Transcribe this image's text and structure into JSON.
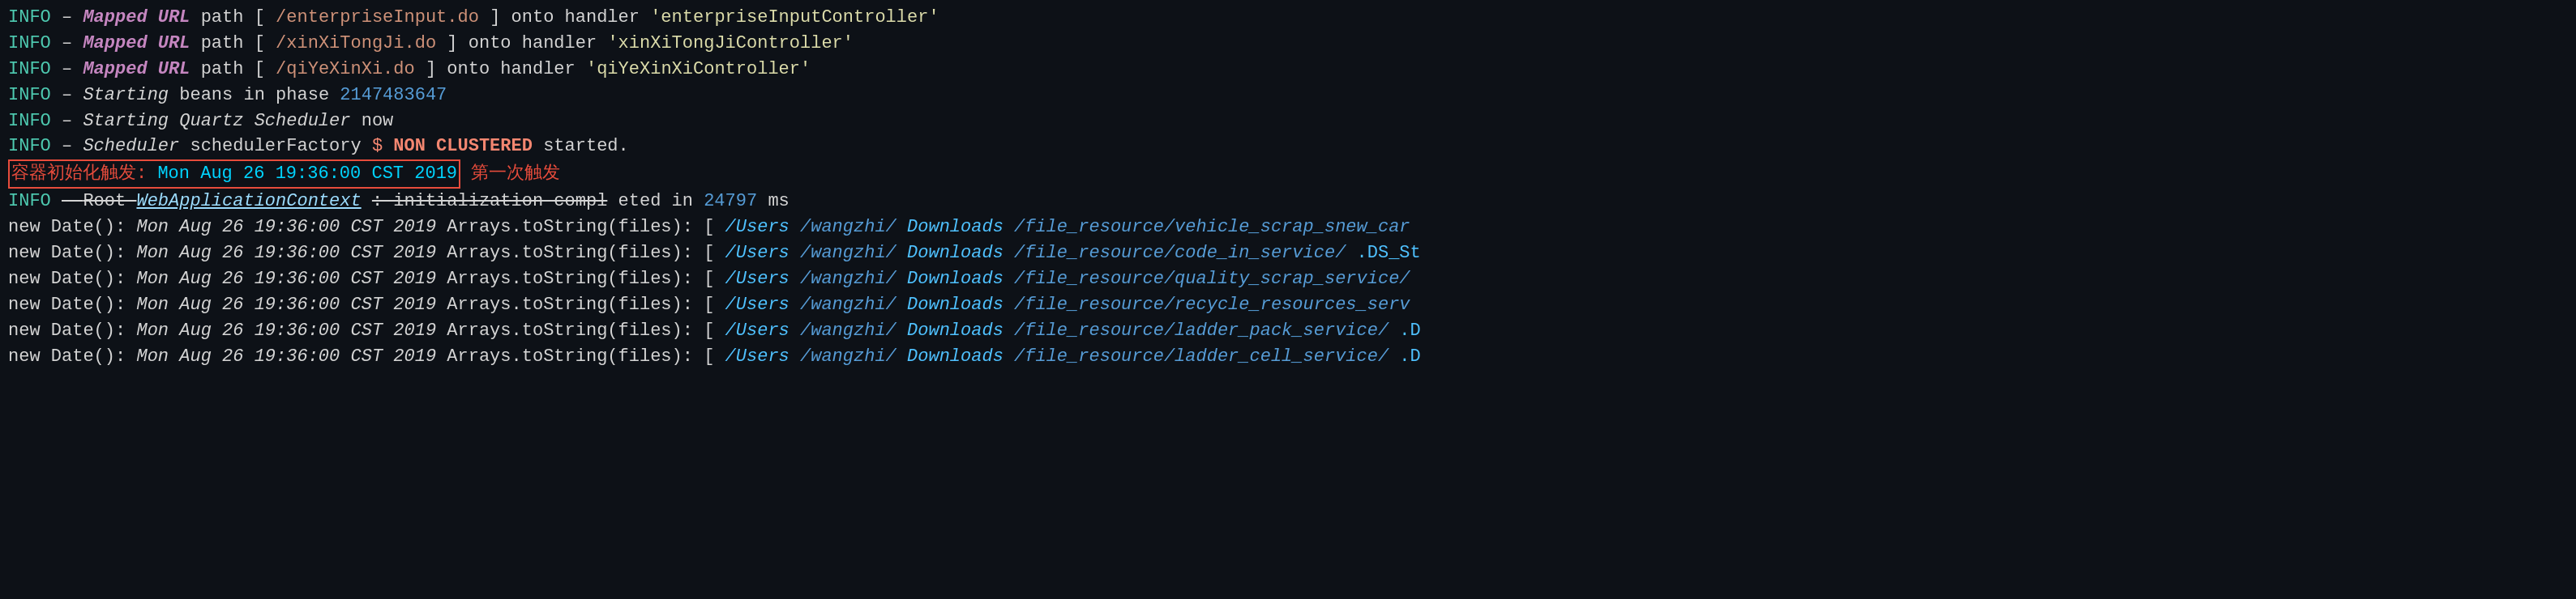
{
  "console": {
    "lines": [
      {
        "id": "line1",
        "type": "info-mapped",
        "text": "INFO – Mapped URL path [/enterpriseInput.do] onto handler 'enterpriseInputController'"
      },
      {
        "id": "line2",
        "type": "info-mapped",
        "text": "INFO – Mapped URL path [/xinXiTongJi.do] onto handler 'xinXiTongJiController'"
      },
      {
        "id": "line3",
        "type": "info-mapped",
        "text": "INFO – Mapped URL path [/qiYeXinXi.do] onto handler 'qiYeXinXiController'"
      },
      {
        "id": "line4",
        "type": "info-starting",
        "text": "INFO – Starting beans in phase 2147483647"
      },
      {
        "id": "line5",
        "type": "info-quartz",
        "text": "INFO – Starting Quartz Scheduler now"
      },
      {
        "id": "line6",
        "type": "info-scheduler",
        "text": "INFO – Scheduler schedulerFactory $ NON CLUSTERED started."
      },
      {
        "id": "line7",
        "type": "container-trigger",
        "highlight": "容器初始化触发: Mon Aug 26 19:36:00 CST 2019",
        "annotation": "第一次触发"
      },
      {
        "id": "line8",
        "type": "info-root",
        "text": "INFO – Root WebApplicationContext: initialization completed in 24797 ms"
      },
      {
        "id": "line9",
        "type": "new-date",
        "prefix": "new Date():Mon Aug 26 19:36:00 CST 2019",
        "suffix": "Arrays.toString(files): [/Users/wangzhi/Downloads/file_resource/vehicle_scrap_snew_car"
      },
      {
        "id": "line10",
        "type": "new-date",
        "prefix": "new Date():Mon Aug 26 19:36:00 CST 2019",
        "suffix": "Arrays.toString(files): [/Users/wangzhi/Downloads/file_resource/code_in_service/.DS_St"
      },
      {
        "id": "line11",
        "type": "new-date",
        "prefix": "new Date():Mon Aug 26 19:36:00 CST 2019",
        "suffix": "Arrays.toString(files): [/Users/wangzhi/Downloads/file_resource/quality_scrap_service/"
      },
      {
        "id": "line12",
        "type": "new-date",
        "prefix": "new Date():Mon Aug 26 19:36:00 CST 2019",
        "suffix": "Arrays.toString(files): [/Users/wangzhi/Downloads/file_resource/recycle_resources_serv"
      },
      {
        "id": "line13",
        "type": "new-date",
        "prefix": "new Date():Mon Aug 26 19:36:00 CST 2019",
        "suffix": "Arrays.toString(files): [/Users/wangzhi/Downloads/file_resource/ladder_pack_service/.D"
      },
      {
        "id": "line14",
        "type": "new-date",
        "prefix": "new Date():Mon Aug 26 19:36:00 CST 2019",
        "suffix": "Arrays.toString(files): [/Users/wangzhi/Downloads/file_resource/ladder_cell_service/.D"
      }
    ]
  }
}
